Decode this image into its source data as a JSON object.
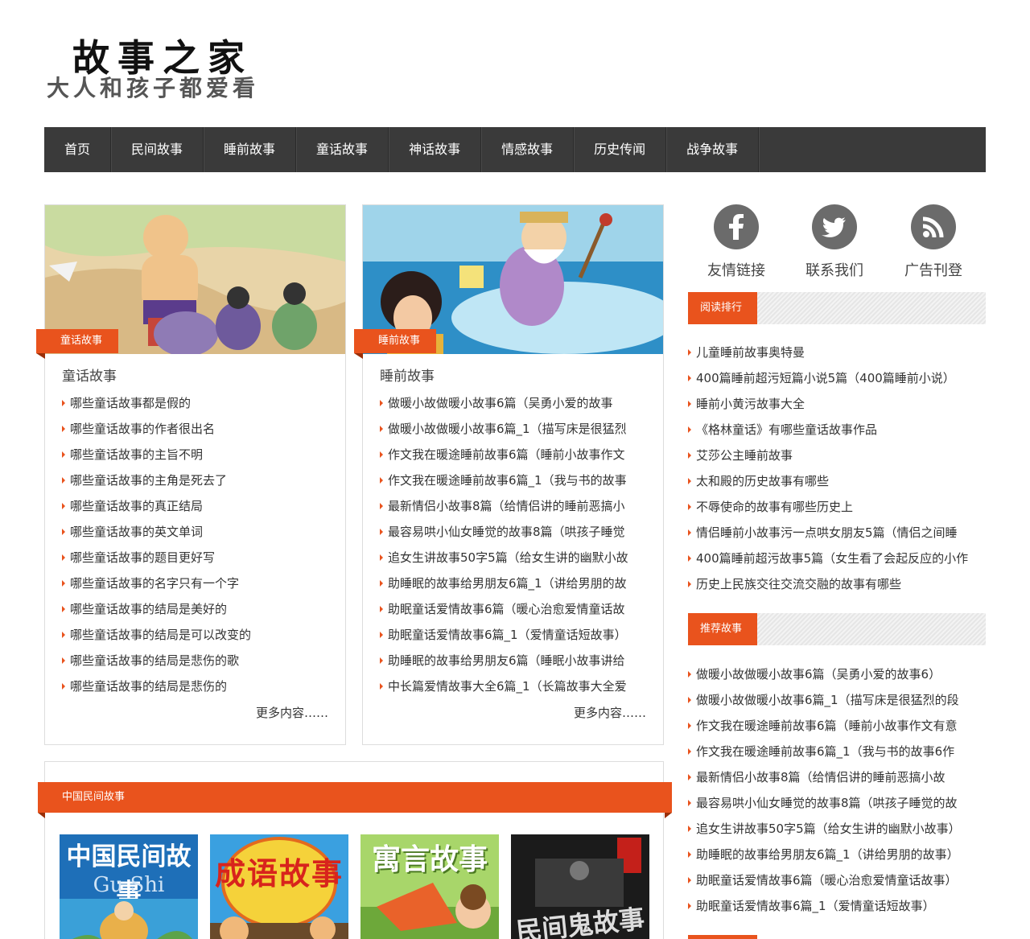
{
  "site": {
    "logo_title": "故事之家",
    "logo_subtitle": "大人和孩子都爱看"
  },
  "nav": [
    "首页",
    "民间故事",
    "睡前故事",
    "童话故事",
    "神话故事",
    "情感故事",
    "历史传闻",
    "战争故事"
  ],
  "cards": [
    {
      "ribbon": "童话故事",
      "title": "童话故事",
      "items": [
        "哪些童话故事都是假的",
        "哪些童话故事的作者很出名",
        "哪些童话故事的主旨不明",
        "哪些童话故事的主角是死去了",
        "哪些童话故事的真正结局",
        "哪些童话故事的英文单词",
        "哪些童话故事的题目更好写",
        "哪些童话故事的名字只有一个字",
        "哪些童话故事的结局是美好的",
        "哪些童话故事的结局是可以改变的",
        "哪些童话故事的结局是悲伤的歌",
        "哪些童话故事的结局是悲伤的"
      ],
      "more": "更多内容……"
    },
    {
      "ribbon": "睡前故事",
      "title": "睡前故事",
      "items": [
        "做暖小故做暖小故事6篇（吴勇小爱的故事",
        "做暖小故做暖小故事6篇_1（描写床是很猛烈",
        "作文我在暖途睡前故事6篇（睡前小故事作文",
        "作文我在暖途睡前故事6篇_1（我与书的故事",
        "最新情侣小故事8篇（给情侣讲的睡前恶搞小",
        "最容易哄小仙女睡觉的故事8篇（哄孩子睡觉",
        "追女生讲故事50字5篇（给女生讲的幽默小故",
        "助睡眠的故事给男朋友6篇_1（讲给男朋的故",
        "助眠童话爱情故事6篇（暖心治愈爱情童话故",
        "助眠童话爱情故事6篇_1（爱情童话短故事）",
        "助睡眠的故事给男朋友6篇（睡眠小故事讲给",
        "中长篇爱情故事大全6篇_1（长篇故事大全爱"
      ],
      "more": "更多内容……"
    }
  ],
  "folk": {
    "bar_label": "中国民间故事",
    "books": [
      {
        "title": "中国民间故事",
        "subtitle": "Gu Shi"
      },
      {
        "title": "成语故事",
        "subtitle": ""
      },
      {
        "title": "寓言故事",
        "subtitle": ""
      },
      {
        "title": "民间鬼故事",
        "subtitle": ""
      }
    ]
  },
  "social": [
    {
      "icon": "facebook-icon",
      "label": "友情链接"
    },
    {
      "icon": "twitter-icon",
      "label": "联系我们"
    },
    {
      "icon": "rss-icon",
      "label": "广告刊登"
    }
  ],
  "reading_rank": {
    "title": "阅读排行",
    "items": [
      "儿童睡前故事奥特曼",
      "400篇睡前超污短篇小说5篇（400篇睡前小说）",
      "睡前小黄污故事大全",
      "《格林童话》有哪些童话故事作品",
      "艾莎公主睡前故事",
      "太和殿的历史故事有哪些",
      "不辱使命的故事有哪些历史上",
      "情侣睡前小故事污一点哄女朋友5篇（情侣之间睡",
      "400篇睡前超污故事5篇（女生看了会起反应的小作",
      "历史上民族交往交流交融的故事有哪些"
    ]
  },
  "recommended": {
    "title": "推荐故事",
    "items": [
      "做暖小故做暖小故事6篇（吴勇小爱的故事6）",
      "做暖小故做暖小故事6篇_1（描写床是很猛烈的段",
      "作文我在暖途睡前故事6篇（睡前小故事作文有意",
      "作文我在暖途睡前故事6篇_1（我与书的故事6作",
      "最新情侣小故事8篇（给情侣讲的睡前恶搞小故",
      "最容易哄小仙女睡觉的故事8篇（哄孩子睡觉的故",
      "追女生讲故事50字5篇（给女生讲的幽默小故事）",
      "助睡眠的故事给男朋友6篇_1（讲给男朋的故事）",
      "助眠童话爱情故事6篇（暖心治愈爱情童话故事）",
      "助眠童话爱情故事6篇_1（爱情童话短故事）"
    ]
  }
}
